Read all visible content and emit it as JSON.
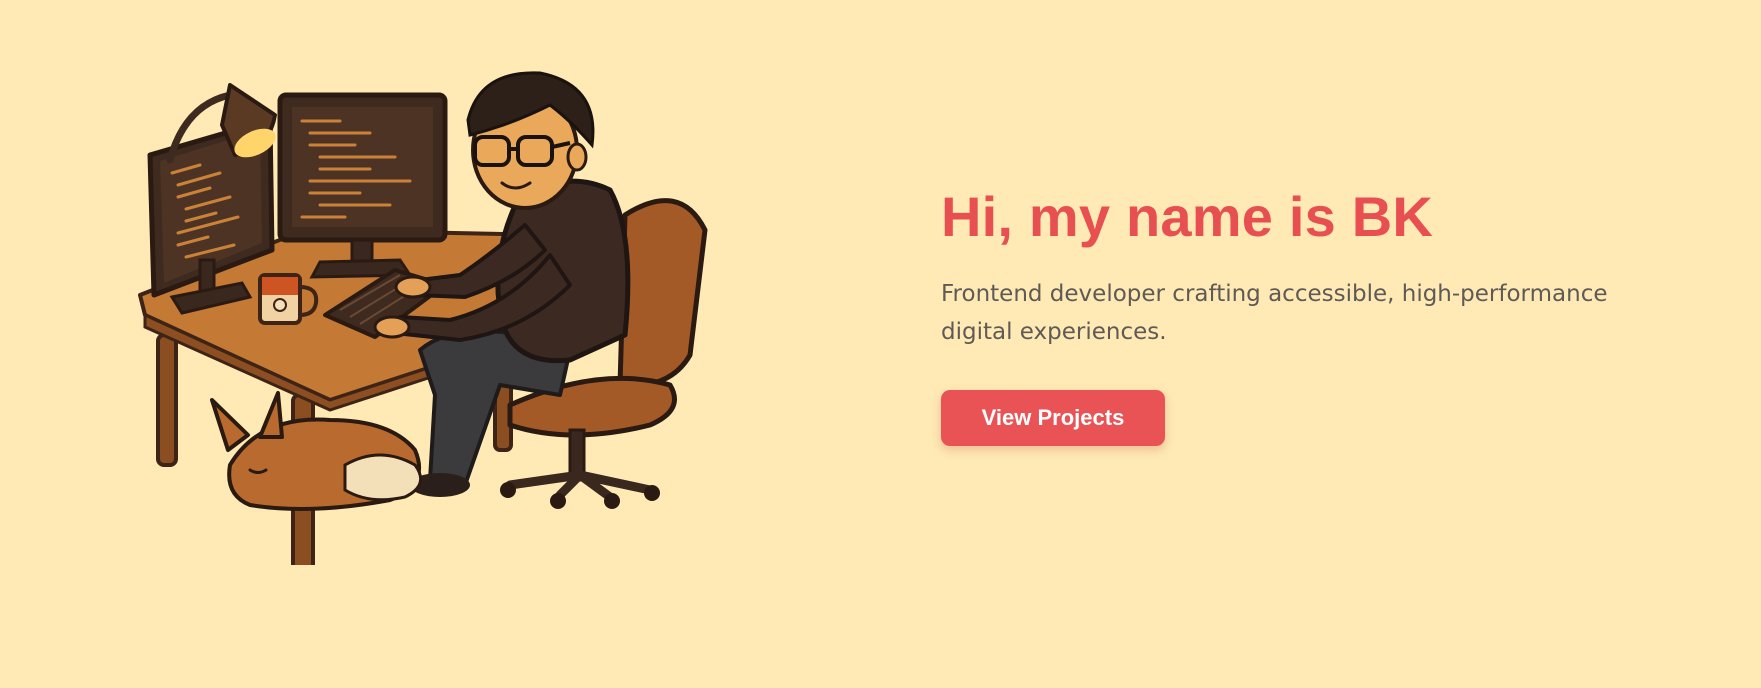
{
  "hero": {
    "title": "Hi, my name is BK",
    "subtitle": "Frontend developer crafting accessible, high-performance digital experiences.",
    "cta_label": "View Projects"
  },
  "colors": {
    "background": "#ffeab5",
    "accent": "#e84f51",
    "subtitle_text": "#5f5a55"
  },
  "illustration": {
    "subject": "developer-at-desk-illustration"
  }
}
